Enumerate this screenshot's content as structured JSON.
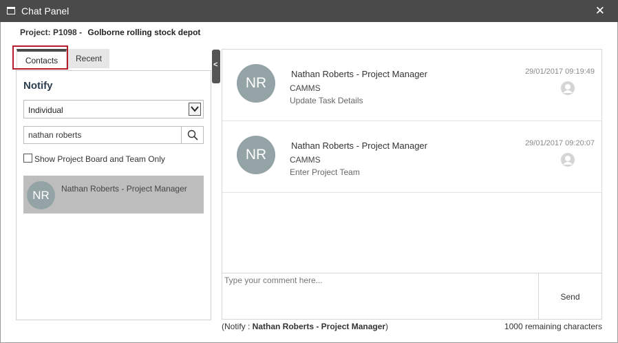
{
  "window": {
    "title": "Chat Panel",
    "close_label": "✕"
  },
  "project": {
    "label": "Project: P1098",
    "separator": "-",
    "name": "Golborne rolling stock depot"
  },
  "tabs": [
    {
      "label": "Contacts",
      "active": true
    },
    {
      "label": "Recent",
      "active": false
    }
  ],
  "notify": {
    "title": "Notify",
    "type_select": {
      "value": "Individual"
    },
    "search": {
      "value": "nathan roberts"
    },
    "board_filter": {
      "label": "Show Project Board and Team Only",
      "checked": false
    },
    "contacts": [
      {
        "initials": "NR",
        "name": "Nathan Roberts - Project Manager"
      }
    ]
  },
  "collapse_label": "<",
  "messages": [
    {
      "initials": "NR",
      "sender": "Nathan Roberts - Project Manager",
      "org": "CAMMS",
      "action": "Update Task Details",
      "time": "29/01/2017 09:19:49"
    },
    {
      "initials": "NR",
      "sender": "Nathan Roberts - Project Manager",
      "org": "CAMMS",
      "action": "Enter Project Team",
      "time": "29/01/2017 09:20:07"
    }
  ],
  "composer": {
    "placeholder": "Type your comment here...",
    "send_label": "Send",
    "notify_prefix": "(Notify : ",
    "notify_target": "Nathan Roberts - Project Manager",
    "notify_suffix": ")",
    "remaining": "1000 remaining characters"
  },
  "colors": {
    "titlebar": "#4a4a4a",
    "avatar": "#93a3a6",
    "selected_contact": "#bdbdbd",
    "highlight_border": "#b71c2c"
  }
}
